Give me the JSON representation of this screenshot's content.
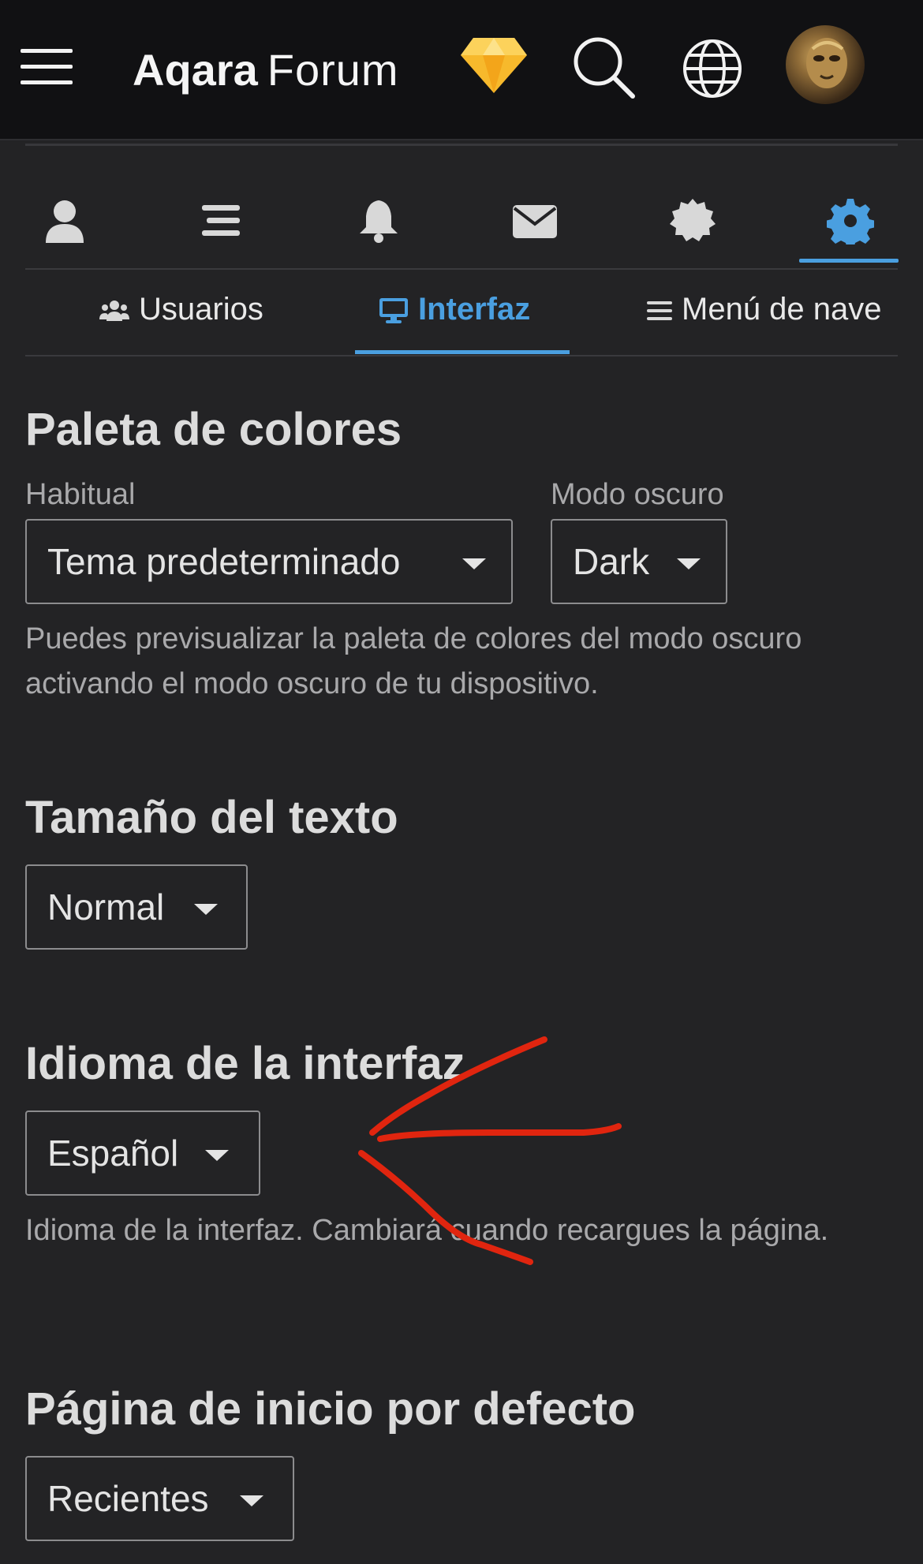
{
  "header": {
    "brand": "Aqara",
    "brand_suffix": "Forum",
    "icons": [
      "menu-icon",
      "diamond-icon",
      "search-icon",
      "globe-icon",
      "user-avatar"
    ]
  },
  "profile_tabs": {
    "icons": [
      "user-icon",
      "activity-icon",
      "bell-icon",
      "envelope-icon",
      "badge-icon",
      "gear-icon"
    ],
    "active": "gear-icon"
  },
  "sub_tabs": {
    "items": [
      {
        "label": "Usuarios",
        "icon": "users-icon"
      },
      {
        "label": "Interfaz",
        "icon": "monitor-icon"
      },
      {
        "label": "Menú de nave",
        "icon": "bars-icon"
      }
    ],
    "active": "Interfaz"
  },
  "sections": {
    "palette": {
      "title": "Paleta de colores",
      "regular_label": "Habitual",
      "regular_value": "Tema predeterminado",
      "dark_label": "Modo oscuro",
      "dark_value": "Dark",
      "help": "Puedes previsualizar la paleta de colores del modo oscuro activando el modo oscuro de tu dispositivo."
    },
    "text_size": {
      "title": "Tamaño del texto",
      "value": "Normal"
    },
    "language": {
      "title": "Idioma de la interfaz",
      "value": "Español",
      "help": "Idioma de la interfaz. Cambiará cuando recargues la página."
    },
    "homepage": {
      "title": "Página de inicio por defecto",
      "value": "Recientes"
    }
  },
  "colors": {
    "background": "#232325",
    "header": "#111113",
    "accent": "#4a9fe0",
    "annotation": "#e0250f"
  }
}
